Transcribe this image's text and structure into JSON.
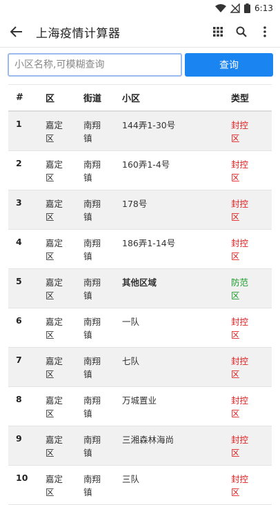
{
  "status": {
    "time": "6:13"
  },
  "app_bar": {
    "title": "上海疫情计算器"
  },
  "search": {
    "placeholder": "小区名称,可模糊查询",
    "button_label": "查询"
  },
  "table": {
    "headers": [
      "#",
      "区",
      "街道",
      "小区",
      "类型"
    ],
    "rows": [
      {
        "num": "1",
        "district": "嘉定区",
        "street": "南翔镇",
        "community": "144弄1-30号",
        "type": "封控区"
      },
      {
        "num": "2",
        "district": "嘉定区",
        "street": "南翔镇",
        "community": "160弄1-4号",
        "type": "封控区"
      },
      {
        "num": "3",
        "district": "嘉定区",
        "street": "南翔镇",
        "community": "178号",
        "type": "封控区"
      },
      {
        "num": "4",
        "district": "嘉定区",
        "street": "南翔镇",
        "community": "186弄1-14号",
        "type": "封控区"
      },
      {
        "num": "5",
        "district": "嘉定区",
        "street": "南翔镇",
        "community": "其他区域",
        "type": "防范区"
      },
      {
        "num": "6",
        "district": "嘉定区",
        "street": "南翔镇",
        "community": "一队",
        "type": "封控区"
      },
      {
        "num": "7",
        "district": "嘉定区",
        "street": "南翔镇",
        "community": "七队",
        "type": "封控区"
      },
      {
        "num": "8",
        "district": "嘉定区",
        "street": "南翔镇",
        "community": "万城置业",
        "type": "封控区"
      },
      {
        "num": "9",
        "district": "嘉定区",
        "street": "南翔镇",
        "community": "三湘森林海尚",
        "type": "封控区"
      },
      {
        "num": "10",
        "district": "嘉定区",
        "street": "南翔镇",
        "community": "三队",
        "type": "封控区"
      }
    ]
  },
  "colors": {
    "accent": "#1a84f0",
    "lockdown": "#e02020",
    "prevention": "#1a9a2a"
  }
}
